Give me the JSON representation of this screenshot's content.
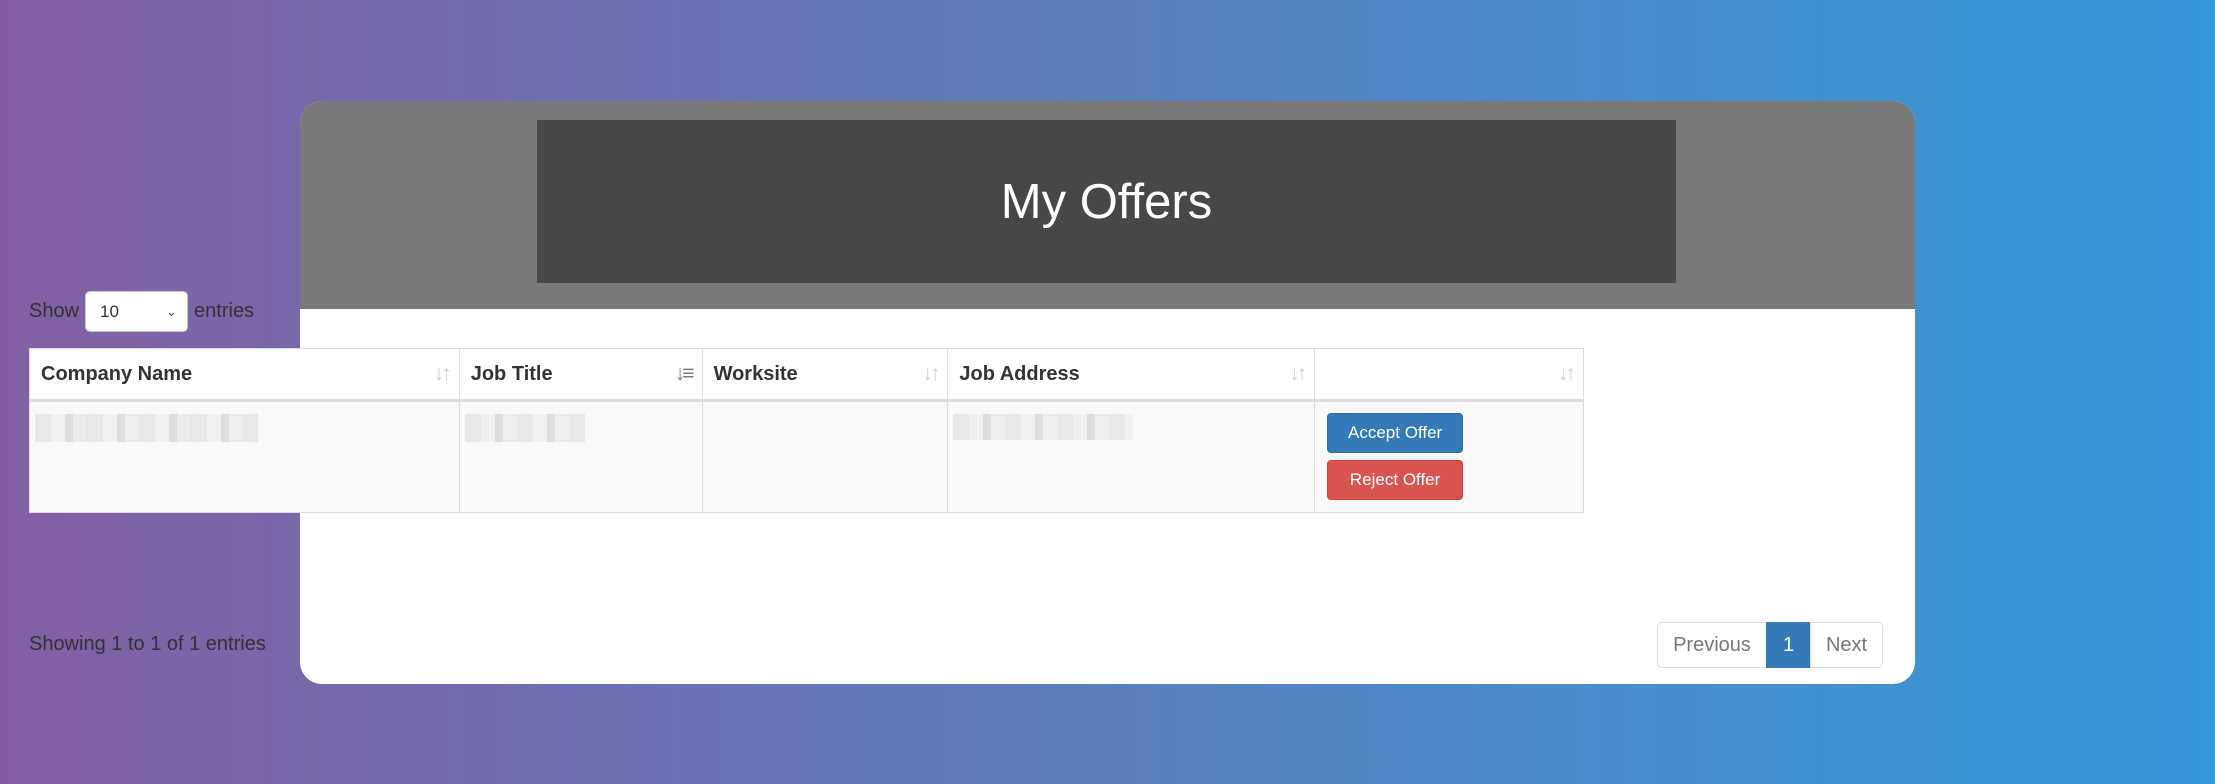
{
  "header": {
    "title": "My Offers"
  },
  "length_menu": {
    "prefix": "Show",
    "selected": "10",
    "suffix": "entries"
  },
  "table": {
    "columns": [
      "Company Name",
      "Job Title",
      "Worksite",
      "Job Address",
      ""
    ],
    "rows": [
      {
        "company": "",
        "job_title": "",
        "worksite": "",
        "job_address": ""
      }
    ],
    "actions": {
      "accept": "Accept Offer",
      "reject": "Reject Offer"
    }
  },
  "info": "Showing 1 to 1 of 1 entries",
  "pagination": {
    "previous": "Previous",
    "current": "1",
    "next": "Next"
  },
  "colors": {
    "accept": "#337ab7",
    "reject": "#d9534f",
    "header_bg": "#797979",
    "title_bg": "#474747"
  }
}
